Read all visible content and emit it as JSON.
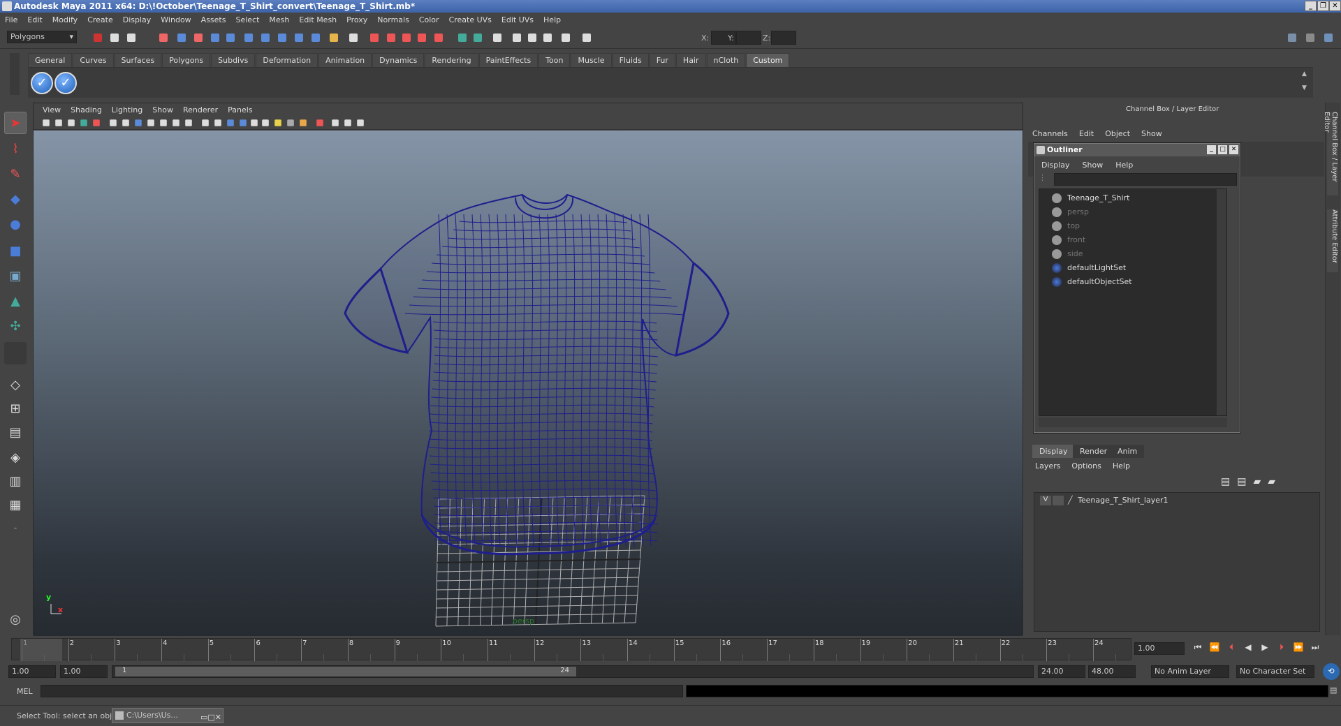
{
  "title": "Autodesk Maya 2011 x64: D:\\!October\\Teenage_T_Shirt_convert\\Teenage_T_Shirt.mb*",
  "window_buttons": [
    "_",
    "❐",
    "✕"
  ],
  "menubar": [
    "File",
    "Edit",
    "Modify",
    "Create",
    "Display",
    "Window",
    "Assets",
    "Select",
    "Mesh",
    "Edit Mesh",
    "Proxy",
    "Normals",
    "Color",
    "Create UVs",
    "Edit UVs",
    "Help"
  ],
  "status": {
    "mode": "Polygons",
    "x_label": "X:",
    "y_label": "Y:",
    "z_label": "Z:"
  },
  "shelf": {
    "tabs": [
      "General",
      "Curves",
      "Surfaces",
      "Polygons",
      "Subdivs",
      "Deformation",
      "Animation",
      "Dynamics",
      "Rendering",
      "PaintEffects",
      "Toon",
      "Muscle",
      "Fluids",
      "Fur",
      "Hair",
      "nCloth",
      "Custom"
    ],
    "active_tab": "Custom"
  },
  "viewport": {
    "menu": [
      "View",
      "Shading",
      "Lighting",
      "Show",
      "Renderer",
      "Panels"
    ],
    "camera_label": "persp",
    "axis_y": "y",
    "axis_x": "x",
    "wire_color": "#1e1e8c"
  },
  "channelbox": {
    "title": "Channel Box / Layer Editor",
    "menu": [
      "Channels",
      "Edit",
      "Object",
      "Show"
    ],
    "side_tab_1": "Channel Box / Layer Editor",
    "side_tab_2": "Attribute Editor"
  },
  "outliner": {
    "title": "Outliner",
    "menu": [
      "Display",
      "Show",
      "Help"
    ],
    "items": [
      {
        "label": "Teenage_T_Shirt",
        "dim": false
      },
      {
        "label": "persp",
        "dim": true
      },
      {
        "label": "top",
        "dim": true
      },
      {
        "label": "front",
        "dim": true
      },
      {
        "label": "side",
        "dim": true
      },
      {
        "label": "defaultLightSet",
        "dim": false
      },
      {
        "label": "defaultObjectSet",
        "dim": false
      }
    ]
  },
  "layers": {
    "tabs": [
      "Display",
      "Render",
      "Anim"
    ],
    "active_tab": "Display",
    "menu": [
      "Layers",
      "Options",
      "Help"
    ],
    "rows": [
      {
        "visible": "V",
        "name": "Teenage_T_Shirt_layer1"
      }
    ]
  },
  "timeline": {
    "start": 1,
    "end": 24,
    "current_frame": "1.00",
    "labels": [
      "1",
      "2",
      "3",
      "4",
      "5",
      "6",
      "7",
      "8",
      "9",
      "10",
      "11",
      "12",
      "13",
      "14",
      "15",
      "16",
      "17",
      "18",
      "19",
      "20",
      "21",
      "22",
      "23",
      "24"
    ]
  },
  "range": {
    "start_time": "1.00",
    "playback_start": "1.00",
    "range_start_label": "1",
    "range_end_label": "24",
    "playback_end": "24.00",
    "end_time": "48.00",
    "anim_layer": "No Anim Layer",
    "char_set": "No Character Set"
  },
  "cmd": {
    "label": "MEL"
  },
  "help": {
    "text": "Select Tool: select an object",
    "task": "C:\\Users\\Us..."
  }
}
